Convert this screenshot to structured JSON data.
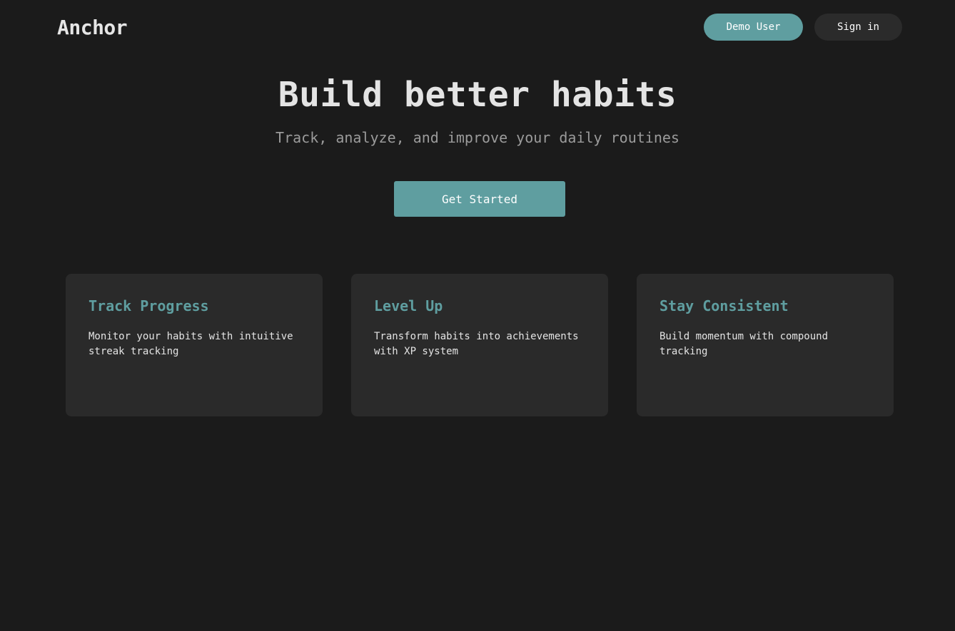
{
  "header": {
    "logo": "Anchor",
    "demo_label": "Demo User",
    "signin_label": "Sign in"
  },
  "hero": {
    "title": "Build better habits",
    "subtitle": "Track, analyze, and improve your daily routines",
    "cta_label": "Get Started"
  },
  "features": [
    {
      "title": "Track Progress",
      "description": "Monitor your habits with intuitive streak tracking"
    },
    {
      "title": "Level Up",
      "description": "Transform habits into achievements with XP system"
    },
    {
      "title": "Stay Consistent",
      "description": "Build momentum with compound tracking"
    }
  ],
  "colors": {
    "background": "#1b1b1b",
    "accent": "#5f9ea0",
    "card": "#2a2a2a"
  }
}
